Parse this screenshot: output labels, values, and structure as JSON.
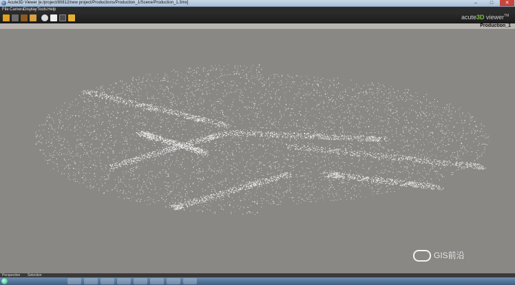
{
  "window": {
    "title": "Acute3D Viewer [e:/project/80812/new project/Productions/Production_1/Scene/Production_1.3mx]"
  },
  "menu": [
    "File",
    "Camera",
    "Display",
    "Tools",
    "Help"
  ],
  "toolbar": {
    "icons": [
      "open-folder-icon",
      "rotate-icon",
      "zoom-icon",
      "pan-hand-icon",
      "settings-icon",
      "square-icon",
      "fullscreen-icon",
      "measure-icon"
    ]
  },
  "brand": {
    "prefix": "acute",
    "highlight": "3D",
    "suffix": " viewer",
    "superscript": "TM"
  },
  "production_label": "Production_1",
  "watermark": {
    "text": "GIS前沿"
  },
  "status": {
    "left": "Perspective",
    "mid": "Selection"
  },
  "colors": {
    "background": "#8b8986",
    "points": "#ffffff",
    "brand_accent": "#7dc142"
  }
}
